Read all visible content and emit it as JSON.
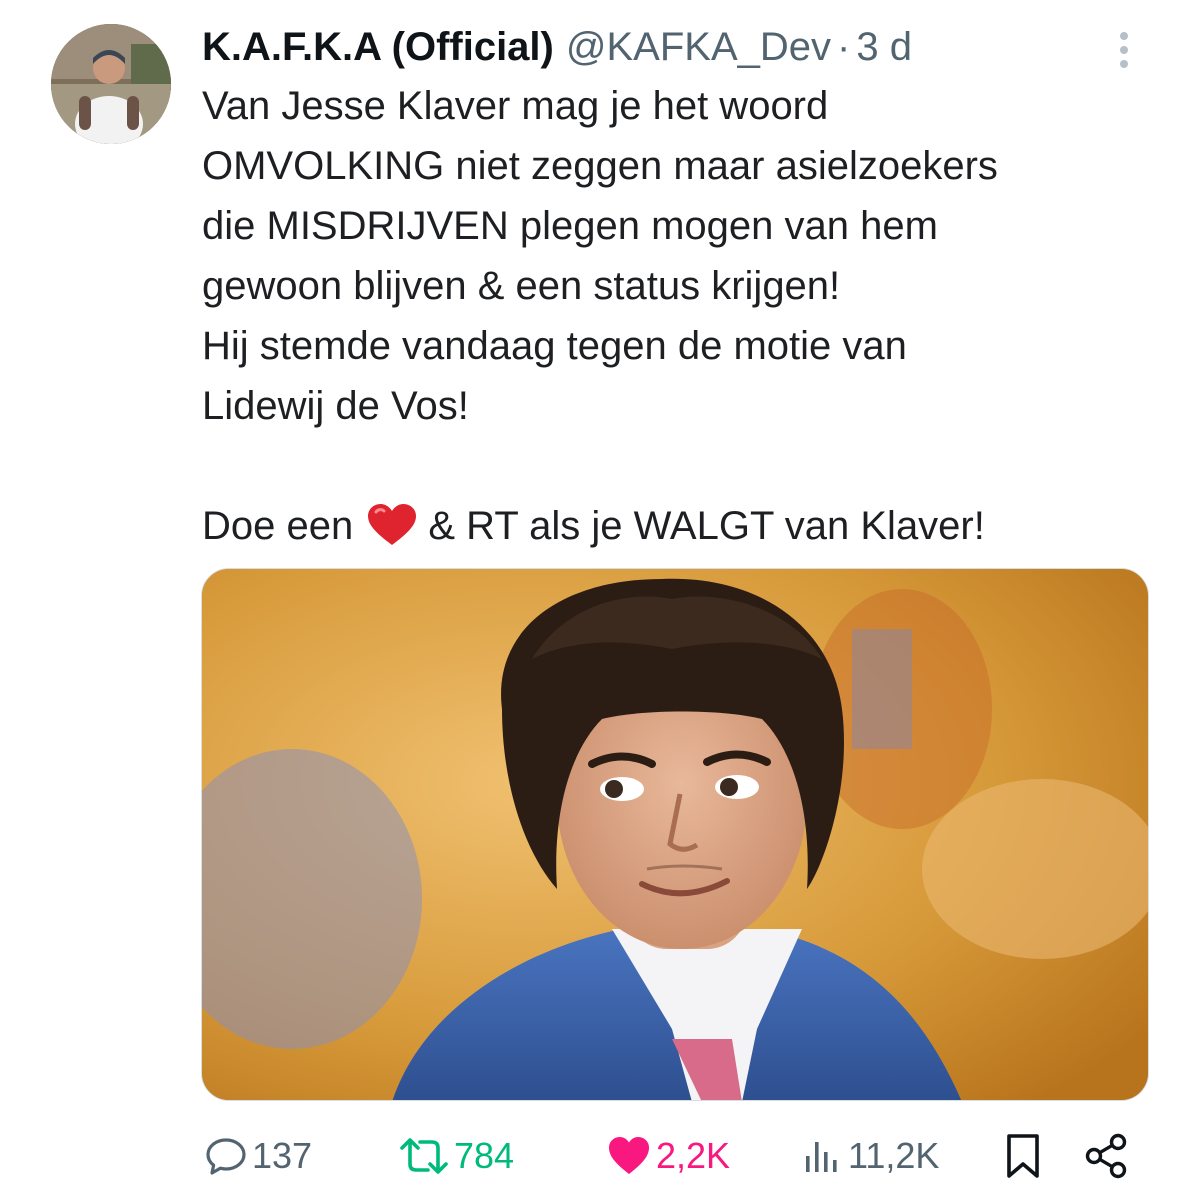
{
  "author": {
    "display_name": "K.A.F.K.A (Official)",
    "handle": "@KAFKA_Dev",
    "separator": "·",
    "timestamp": "3 d"
  },
  "tweet": {
    "lines": [
      "Van Jesse Klaver mag je het woord",
      "OMVOLKING niet zeggen maar asielzoekers",
      "die MISDRIJVEN plegen mogen van hem",
      "gewoon blijven & een status krijgen!",
      "Hij stemde vandaag tegen de motie van",
      "Lidewij de Vos!"
    ],
    "cta_before": "Doe een",
    "cta_emoji": "red-heart-emoji",
    "cta_after": "& RT als je WALGT van Klaver!"
  },
  "stats": {
    "replies": "137",
    "retweets": "784",
    "likes": "2,2K",
    "views": "11,2K"
  },
  "icons": {
    "more": "more-vertical-icon",
    "reply": "reply-icon",
    "retweet": "retweet-icon",
    "like": "heart-filled-icon",
    "views": "views-icon",
    "bookmark": "bookmark-icon",
    "share": "share-icon"
  },
  "colors": {
    "text": "#0f1419",
    "secondary": "#536471",
    "retweet_green": "#00ba7c",
    "like_pink": "#f91880",
    "heart_red": "#e0242f"
  }
}
